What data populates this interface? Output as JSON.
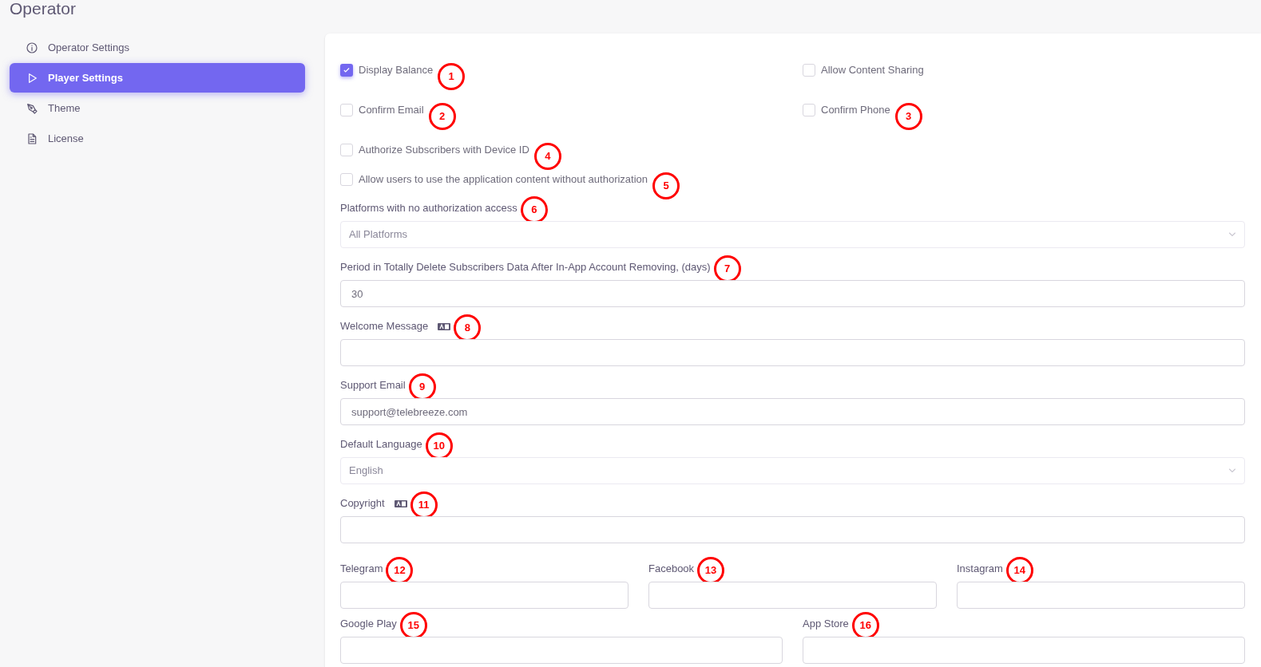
{
  "page_title": "Operator",
  "sidebar": {
    "items": [
      {
        "label": "Operator Settings",
        "selected": false
      },
      {
        "label": "Player Settings",
        "selected": true
      },
      {
        "label": "Theme",
        "selected": false
      },
      {
        "label": "License",
        "selected": false
      }
    ]
  },
  "checkbox_grid": [
    {
      "label": "Display Balance",
      "checked": true,
      "callout": "1"
    },
    {
      "label": "Allow Content Sharing",
      "checked": false
    },
    {
      "label": "Confirm Email",
      "checked": false,
      "callout": "2"
    },
    {
      "label": "Confirm Phone",
      "checked": false,
      "callout": "3"
    }
  ],
  "fields": [
    {
      "kind": "checkbox",
      "label": "Authorize Subscribers with Device ID",
      "checked": false,
      "callout": "4"
    },
    {
      "kind": "checkbox",
      "label": "Allow users to use the application content without authorization",
      "checked": false,
      "callout": "5"
    },
    {
      "kind": "select",
      "label": "Platforms with no authorization access",
      "value": "All Platforms",
      "callout": "6"
    },
    {
      "kind": "input",
      "label": "Period in Totally Delete Subscribers Data After In-App Account Removing, (days)",
      "value": "30",
      "translatable": false,
      "callout": "7"
    },
    {
      "kind": "input",
      "label": "Welcome Message",
      "translatable": true,
      "callout": "8"
    },
    {
      "kind": "input",
      "label": "Support Email",
      "value": "support@telebreeze.com",
      "translatable": false,
      "callout": "9"
    },
    {
      "kind": "select",
      "label": "Default Language",
      "value": "English",
      "callout": "10"
    },
    {
      "kind": "input",
      "label": "Copyright",
      "translatable": true,
      "callout": "11"
    }
  ],
  "social_row_1": [
    {
      "label": "Telegram",
      "callout": "12"
    },
    {
      "label": "Facebook",
      "callout": "13"
    },
    {
      "label": "Instagram",
      "callout": "14"
    }
  ],
  "social_row_2": [
    {
      "label": "Google Play",
      "callout": "15"
    },
    {
      "label": "App Store",
      "callout": "16"
    }
  ]
}
